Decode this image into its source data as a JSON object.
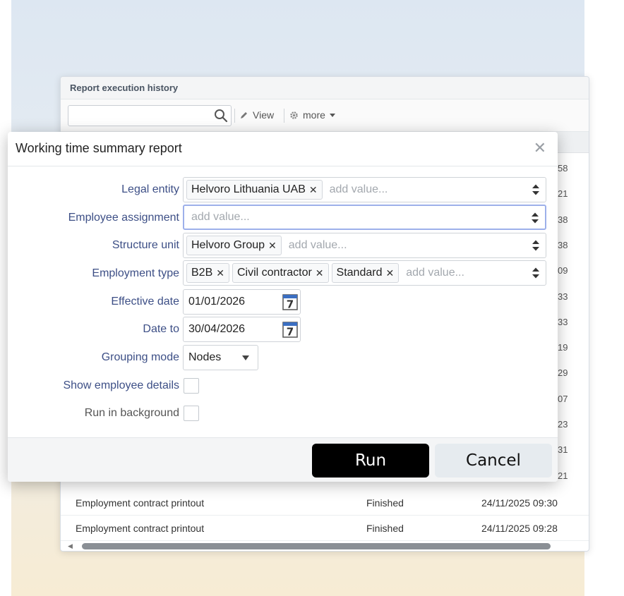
{
  "history": {
    "title": "Report execution history",
    "search_placeholder": "",
    "view_label": "View",
    "more_label": "more",
    "rows": [
      {
        "name": "Employment contract printout",
        "status": "Finished",
        "date": "24/11/2025 09:30"
      },
      {
        "name": "Employment contract printout",
        "status": "Finished",
        "date": "24/11/2025 09:28"
      }
    ],
    "partial_times": [
      "58",
      "21",
      "38",
      "38",
      "09",
      "33",
      "33",
      "19",
      "29",
      "07",
      "23",
      "31",
      "21"
    ]
  },
  "dialog": {
    "title": "Working time summary report",
    "close_glyph": "✕",
    "fields": {
      "legal_entity": {
        "label": "Legal entity",
        "tags": [
          "Helvoro Lithuania UAB"
        ],
        "placeholder": "add value..."
      },
      "employee_assignment": {
        "label": "Employee assignment",
        "tags": [],
        "placeholder": "add value..."
      },
      "structure_unit": {
        "label": "Structure unit",
        "tags": [
          "Helvoro Group"
        ],
        "placeholder": "add value..."
      },
      "employment_type": {
        "label": "Employment type",
        "tags": [
          "B2B",
          "Civil contractor",
          "Standard"
        ],
        "placeholder": "add value..."
      },
      "effective_date": {
        "label": "Effective date",
        "value": "01/01/2026"
      },
      "date_to": {
        "label": "Date to",
        "value": "30/04/2026"
      },
      "grouping_mode": {
        "label": "Grouping mode",
        "value": "Nodes"
      },
      "show_employee_details": {
        "label": "Show employee details",
        "checked": false
      },
      "run_in_background": {
        "label": "Run in background",
        "checked": false
      }
    },
    "calendar_day": "7",
    "tag_remove_glyph": "✕",
    "buttons": {
      "run": "Run",
      "cancel": "Cancel"
    }
  }
}
